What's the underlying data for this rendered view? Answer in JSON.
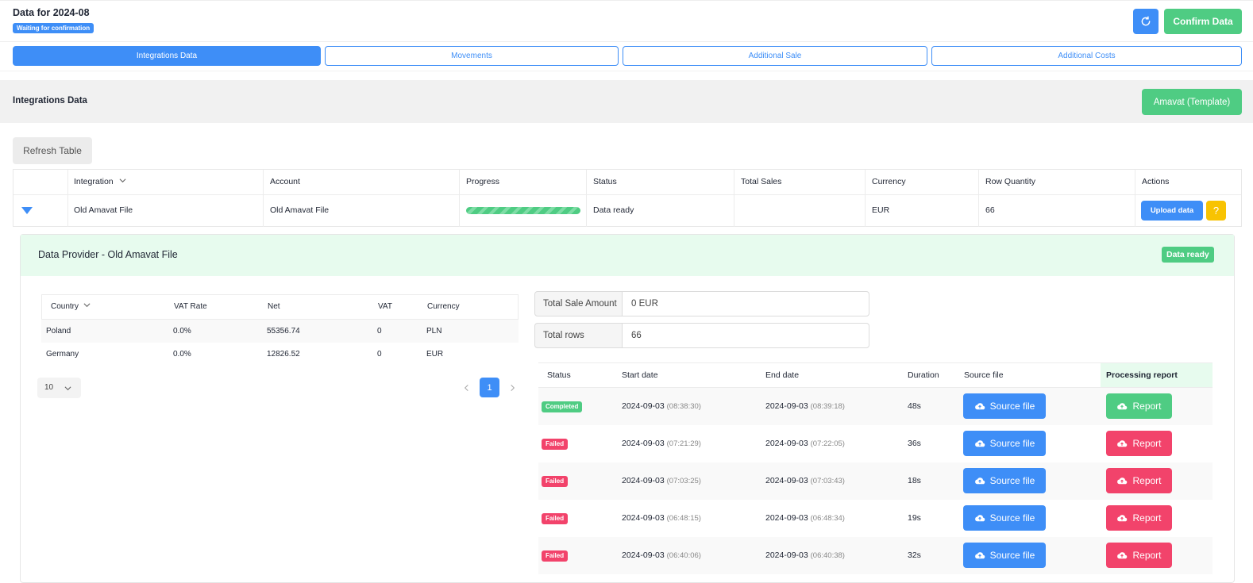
{
  "header": {
    "title": "Data for 2024-08",
    "status_badge": "Waiting for confirmation",
    "confirm_label": "Confirm Data"
  },
  "tabs": [
    {
      "label": "Integrations Data",
      "active": true
    },
    {
      "label": "Movements",
      "active": false
    },
    {
      "label": "Additional Sale",
      "active": false
    },
    {
      "label": "Additional Costs",
      "active": false
    }
  ],
  "section": {
    "title": "Integrations Data",
    "template_button": "Amavat (Template)",
    "refresh_table": "Refresh Table"
  },
  "integrations_table": {
    "columns": [
      "Integration",
      "Account",
      "Progress",
      "Status",
      "Total Sales",
      "Currency",
      "Row Quantity",
      "Actions"
    ],
    "row": {
      "integration": "Old Amavat File",
      "account": "Old Amavat File",
      "progress": 1.0,
      "status": "Data ready",
      "total_sales": "",
      "currency": "EUR",
      "row_quantity": "66",
      "upload_label": "Upload data",
      "help_label": "?"
    }
  },
  "data_provider": {
    "title": "Data Provider - Old Amavat File",
    "status_badge": "Data ready",
    "country_table": {
      "columns": [
        "Country",
        "VAT Rate",
        "Net",
        "VAT",
        "Currency"
      ],
      "rows": [
        [
          "Poland",
          "0.0%",
          "55356.74",
          "0",
          "PLN"
        ],
        [
          "Germany",
          "0.0%",
          "12826.52",
          "0",
          "EUR"
        ]
      ],
      "page_size": "10",
      "current_page": "1"
    },
    "totals": {
      "sale_label": "Total Sale Amount",
      "sale_value": "0 EUR",
      "rows_label": "Total rows",
      "rows_value": "66"
    },
    "processing_table": {
      "columns": [
        "Status",
        "Start date",
        "End date",
        "Duration",
        "Source file",
        "Processing report"
      ],
      "source_label": "Source file",
      "report_label": "Report",
      "rows": [
        {
          "status": "Completed",
          "start_date": "2024-09-03",
          "start_time": "(08:38:30)",
          "end_date": "2024-09-03",
          "end_time": "(08:39:18)",
          "duration": "48s"
        },
        {
          "status": "Failed",
          "start_date": "2024-09-03",
          "start_time": "(07:21:29)",
          "end_date": "2024-09-03",
          "end_time": "(07:22:05)",
          "duration": "36s"
        },
        {
          "status": "Failed",
          "start_date": "2024-09-03",
          "start_time": "(07:03:25)",
          "end_date": "2024-09-03",
          "end_time": "(07:03:43)",
          "duration": "18s"
        },
        {
          "status": "Failed",
          "start_date": "2024-09-03",
          "start_time": "(06:48:15)",
          "end_date": "2024-09-03",
          "end_time": "(06:48:34)",
          "duration": "19s"
        },
        {
          "status": "Failed",
          "start_date": "2024-09-03",
          "start_time": "(06:40:06)",
          "end_date": "2024-09-03",
          "end_time": "(06:40:38)",
          "duration": "32s"
        }
      ]
    }
  },
  "colors": {
    "primary": "#3e8ef7",
    "success": "#4fcc83",
    "danger": "#f2436b",
    "warning": "#f8c302"
  }
}
